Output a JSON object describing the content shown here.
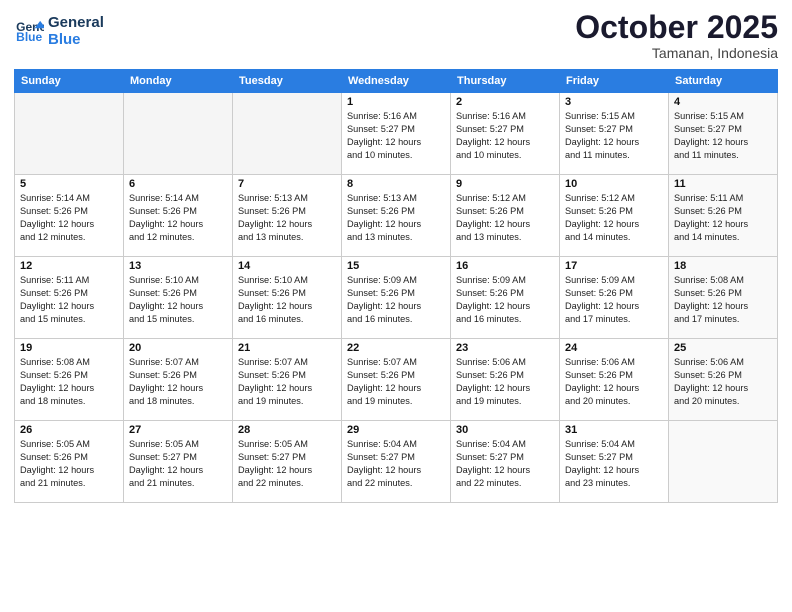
{
  "header": {
    "logo_line1": "General",
    "logo_line2": "Blue",
    "month": "October 2025",
    "location": "Tamanan, Indonesia"
  },
  "weekdays": [
    "Sunday",
    "Monday",
    "Tuesday",
    "Wednesday",
    "Thursday",
    "Friday",
    "Saturday"
  ],
  "weeks": [
    [
      {
        "day": "",
        "info": ""
      },
      {
        "day": "",
        "info": ""
      },
      {
        "day": "",
        "info": ""
      },
      {
        "day": "1",
        "info": "Sunrise: 5:16 AM\nSunset: 5:27 PM\nDaylight: 12 hours\nand 10 minutes."
      },
      {
        "day": "2",
        "info": "Sunrise: 5:16 AM\nSunset: 5:27 PM\nDaylight: 12 hours\nand 10 minutes."
      },
      {
        "day": "3",
        "info": "Sunrise: 5:15 AM\nSunset: 5:27 PM\nDaylight: 12 hours\nand 11 minutes."
      },
      {
        "day": "4",
        "info": "Sunrise: 5:15 AM\nSunset: 5:27 PM\nDaylight: 12 hours\nand 11 minutes."
      }
    ],
    [
      {
        "day": "5",
        "info": "Sunrise: 5:14 AM\nSunset: 5:26 PM\nDaylight: 12 hours\nand 12 minutes."
      },
      {
        "day": "6",
        "info": "Sunrise: 5:14 AM\nSunset: 5:26 PM\nDaylight: 12 hours\nand 12 minutes."
      },
      {
        "day": "7",
        "info": "Sunrise: 5:13 AM\nSunset: 5:26 PM\nDaylight: 12 hours\nand 13 minutes."
      },
      {
        "day": "8",
        "info": "Sunrise: 5:13 AM\nSunset: 5:26 PM\nDaylight: 12 hours\nand 13 minutes."
      },
      {
        "day": "9",
        "info": "Sunrise: 5:12 AM\nSunset: 5:26 PM\nDaylight: 12 hours\nand 13 minutes."
      },
      {
        "day": "10",
        "info": "Sunrise: 5:12 AM\nSunset: 5:26 PM\nDaylight: 12 hours\nand 14 minutes."
      },
      {
        "day": "11",
        "info": "Sunrise: 5:11 AM\nSunset: 5:26 PM\nDaylight: 12 hours\nand 14 minutes."
      }
    ],
    [
      {
        "day": "12",
        "info": "Sunrise: 5:11 AM\nSunset: 5:26 PM\nDaylight: 12 hours\nand 15 minutes."
      },
      {
        "day": "13",
        "info": "Sunrise: 5:10 AM\nSunset: 5:26 PM\nDaylight: 12 hours\nand 15 minutes."
      },
      {
        "day": "14",
        "info": "Sunrise: 5:10 AM\nSunset: 5:26 PM\nDaylight: 12 hours\nand 16 minutes."
      },
      {
        "day": "15",
        "info": "Sunrise: 5:09 AM\nSunset: 5:26 PM\nDaylight: 12 hours\nand 16 minutes."
      },
      {
        "day": "16",
        "info": "Sunrise: 5:09 AM\nSunset: 5:26 PM\nDaylight: 12 hours\nand 16 minutes."
      },
      {
        "day": "17",
        "info": "Sunrise: 5:09 AM\nSunset: 5:26 PM\nDaylight: 12 hours\nand 17 minutes."
      },
      {
        "day": "18",
        "info": "Sunrise: 5:08 AM\nSunset: 5:26 PM\nDaylight: 12 hours\nand 17 minutes."
      }
    ],
    [
      {
        "day": "19",
        "info": "Sunrise: 5:08 AM\nSunset: 5:26 PM\nDaylight: 12 hours\nand 18 minutes."
      },
      {
        "day": "20",
        "info": "Sunrise: 5:07 AM\nSunset: 5:26 PM\nDaylight: 12 hours\nand 18 minutes."
      },
      {
        "day": "21",
        "info": "Sunrise: 5:07 AM\nSunset: 5:26 PM\nDaylight: 12 hours\nand 19 minutes."
      },
      {
        "day": "22",
        "info": "Sunrise: 5:07 AM\nSunset: 5:26 PM\nDaylight: 12 hours\nand 19 minutes."
      },
      {
        "day": "23",
        "info": "Sunrise: 5:06 AM\nSunset: 5:26 PM\nDaylight: 12 hours\nand 19 minutes."
      },
      {
        "day": "24",
        "info": "Sunrise: 5:06 AM\nSunset: 5:26 PM\nDaylight: 12 hours\nand 20 minutes."
      },
      {
        "day": "25",
        "info": "Sunrise: 5:06 AM\nSunset: 5:26 PM\nDaylight: 12 hours\nand 20 minutes."
      }
    ],
    [
      {
        "day": "26",
        "info": "Sunrise: 5:05 AM\nSunset: 5:26 PM\nDaylight: 12 hours\nand 21 minutes."
      },
      {
        "day": "27",
        "info": "Sunrise: 5:05 AM\nSunset: 5:27 PM\nDaylight: 12 hours\nand 21 minutes."
      },
      {
        "day": "28",
        "info": "Sunrise: 5:05 AM\nSunset: 5:27 PM\nDaylight: 12 hours\nand 22 minutes."
      },
      {
        "day": "29",
        "info": "Sunrise: 5:04 AM\nSunset: 5:27 PM\nDaylight: 12 hours\nand 22 minutes."
      },
      {
        "day": "30",
        "info": "Sunrise: 5:04 AM\nSunset: 5:27 PM\nDaylight: 12 hours\nand 22 minutes."
      },
      {
        "day": "31",
        "info": "Sunrise: 5:04 AM\nSunset: 5:27 PM\nDaylight: 12 hours\nand 23 minutes."
      },
      {
        "day": "",
        "info": ""
      }
    ]
  ]
}
